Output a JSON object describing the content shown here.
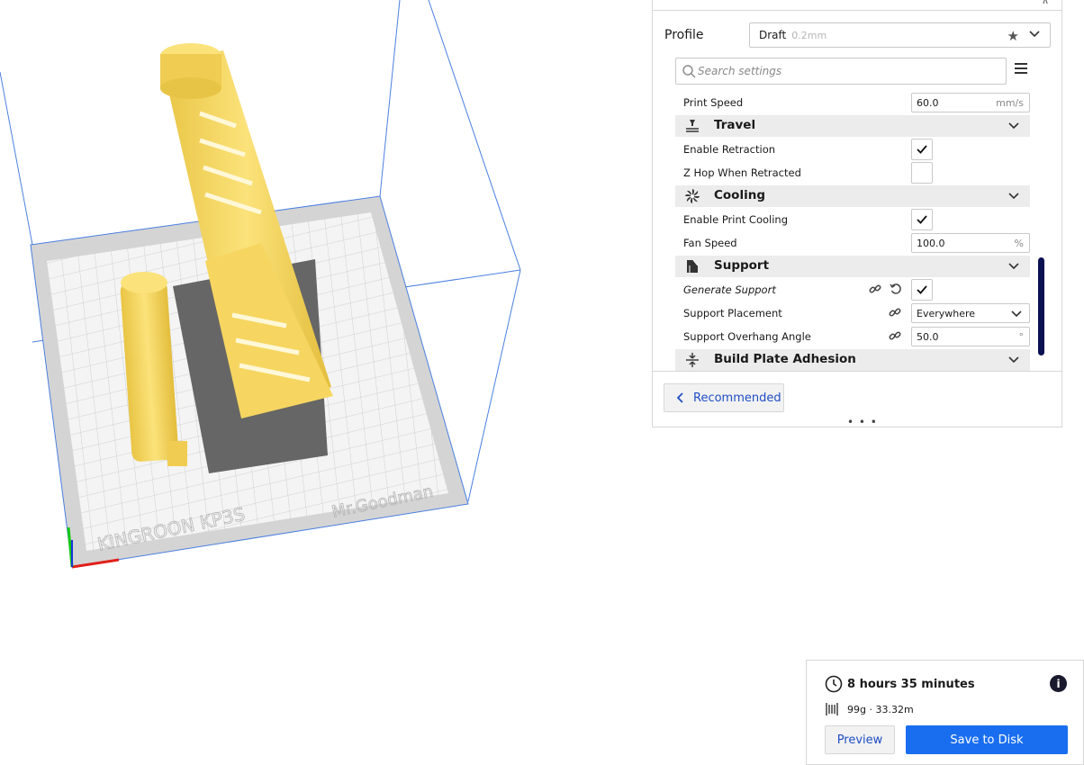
{
  "settings": {
    "profile_label": "Profile",
    "profile_value": "Draft",
    "profile_layer": "0.2mm",
    "search_placeholder": "Search settings",
    "print_speed": {
      "label": "Print Speed",
      "value": "60.0",
      "unit": "mm/s"
    },
    "travel": {
      "title": "Travel",
      "icon": "travel-icon"
    },
    "enable_retraction": {
      "label": "Enable Retraction",
      "checked": true
    },
    "z_hop": {
      "label": "Z Hop When Retracted",
      "checked": false
    },
    "cooling": {
      "title": "Cooling",
      "icon": "fan-icon"
    },
    "enable_cooling": {
      "label": "Enable Print Cooling",
      "checked": true
    },
    "fan_speed": {
      "label": "Fan Speed",
      "value": "100.0",
      "unit": "%"
    },
    "support": {
      "title": "Support",
      "icon": "support-icon"
    },
    "generate_support": {
      "label": "Generate Support",
      "checked": true
    },
    "support_placement": {
      "label": "Support Placement",
      "value": "Everywhere"
    },
    "overhang_angle": {
      "label": "Support Overhang Angle",
      "value": "50.0",
      "unit": "°"
    },
    "adhesion": {
      "title": "Build Plate Adhesion",
      "icon": "adhesion-icon"
    },
    "recommended_label": "Recommended",
    "drag_handle": "• • •"
  },
  "estimate": {
    "time": "8 hours 35 minutes",
    "material": "99g · 33.32m",
    "preview_label": "Preview",
    "save_label": "Save to Disk",
    "info_symbol": "i"
  },
  "colors": {
    "accent": "#196ef0",
    "link": "#1f4ec4",
    "model": "#f5d35a",
    "scrollbar": "#0c1152"
  }
}
